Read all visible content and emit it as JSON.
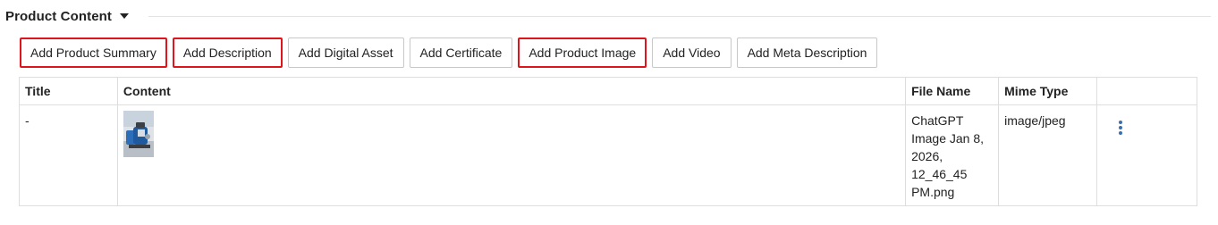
{
  "section": {
    "title": "Product Content",
    "caret_icon": "caret-down-icon"
  },
  "toolbar": {
    "buttons": [
      {
        "label": "Add Product Summary",
        "highlighted": true
      },
      {
        "label": "Add Description",
        "highlighted": true
      },
      {
        "label": "Add Digital Asset",
        "highlighted": false
      },
      {
        "label": "Add Certificate",
        "highlighted": false
      },
      {
        "label": "Add Product Image",
        "highlighted": true
      },
      {
        "label": "Add Video",
        "highlighted": false
      },
      {
        "label": "Add Meta Description",
        "highlighted": false
      }
    ],
    "highlight_color": "#e0141c"
  },
  "table": {
    "columns": [
      "Title",
      "Content",
      "File Name",
      "Mime Type",
      ""
    ],
    "rows": [
      {
        "title": "-",
        "content_thumbnail": "vacuum-pump-image",
        "file_name": "ChatGPT Image Jan 8, 2026, 12_46_45 PM.png",
        "mime_type": "image/jpeg",
        "actions_icon": "kebab-menu-icon"
      }
    ]
  },
  "colors": {
    "accent": "#3a6fb0",
    "border": "#dedede"
  }
}
